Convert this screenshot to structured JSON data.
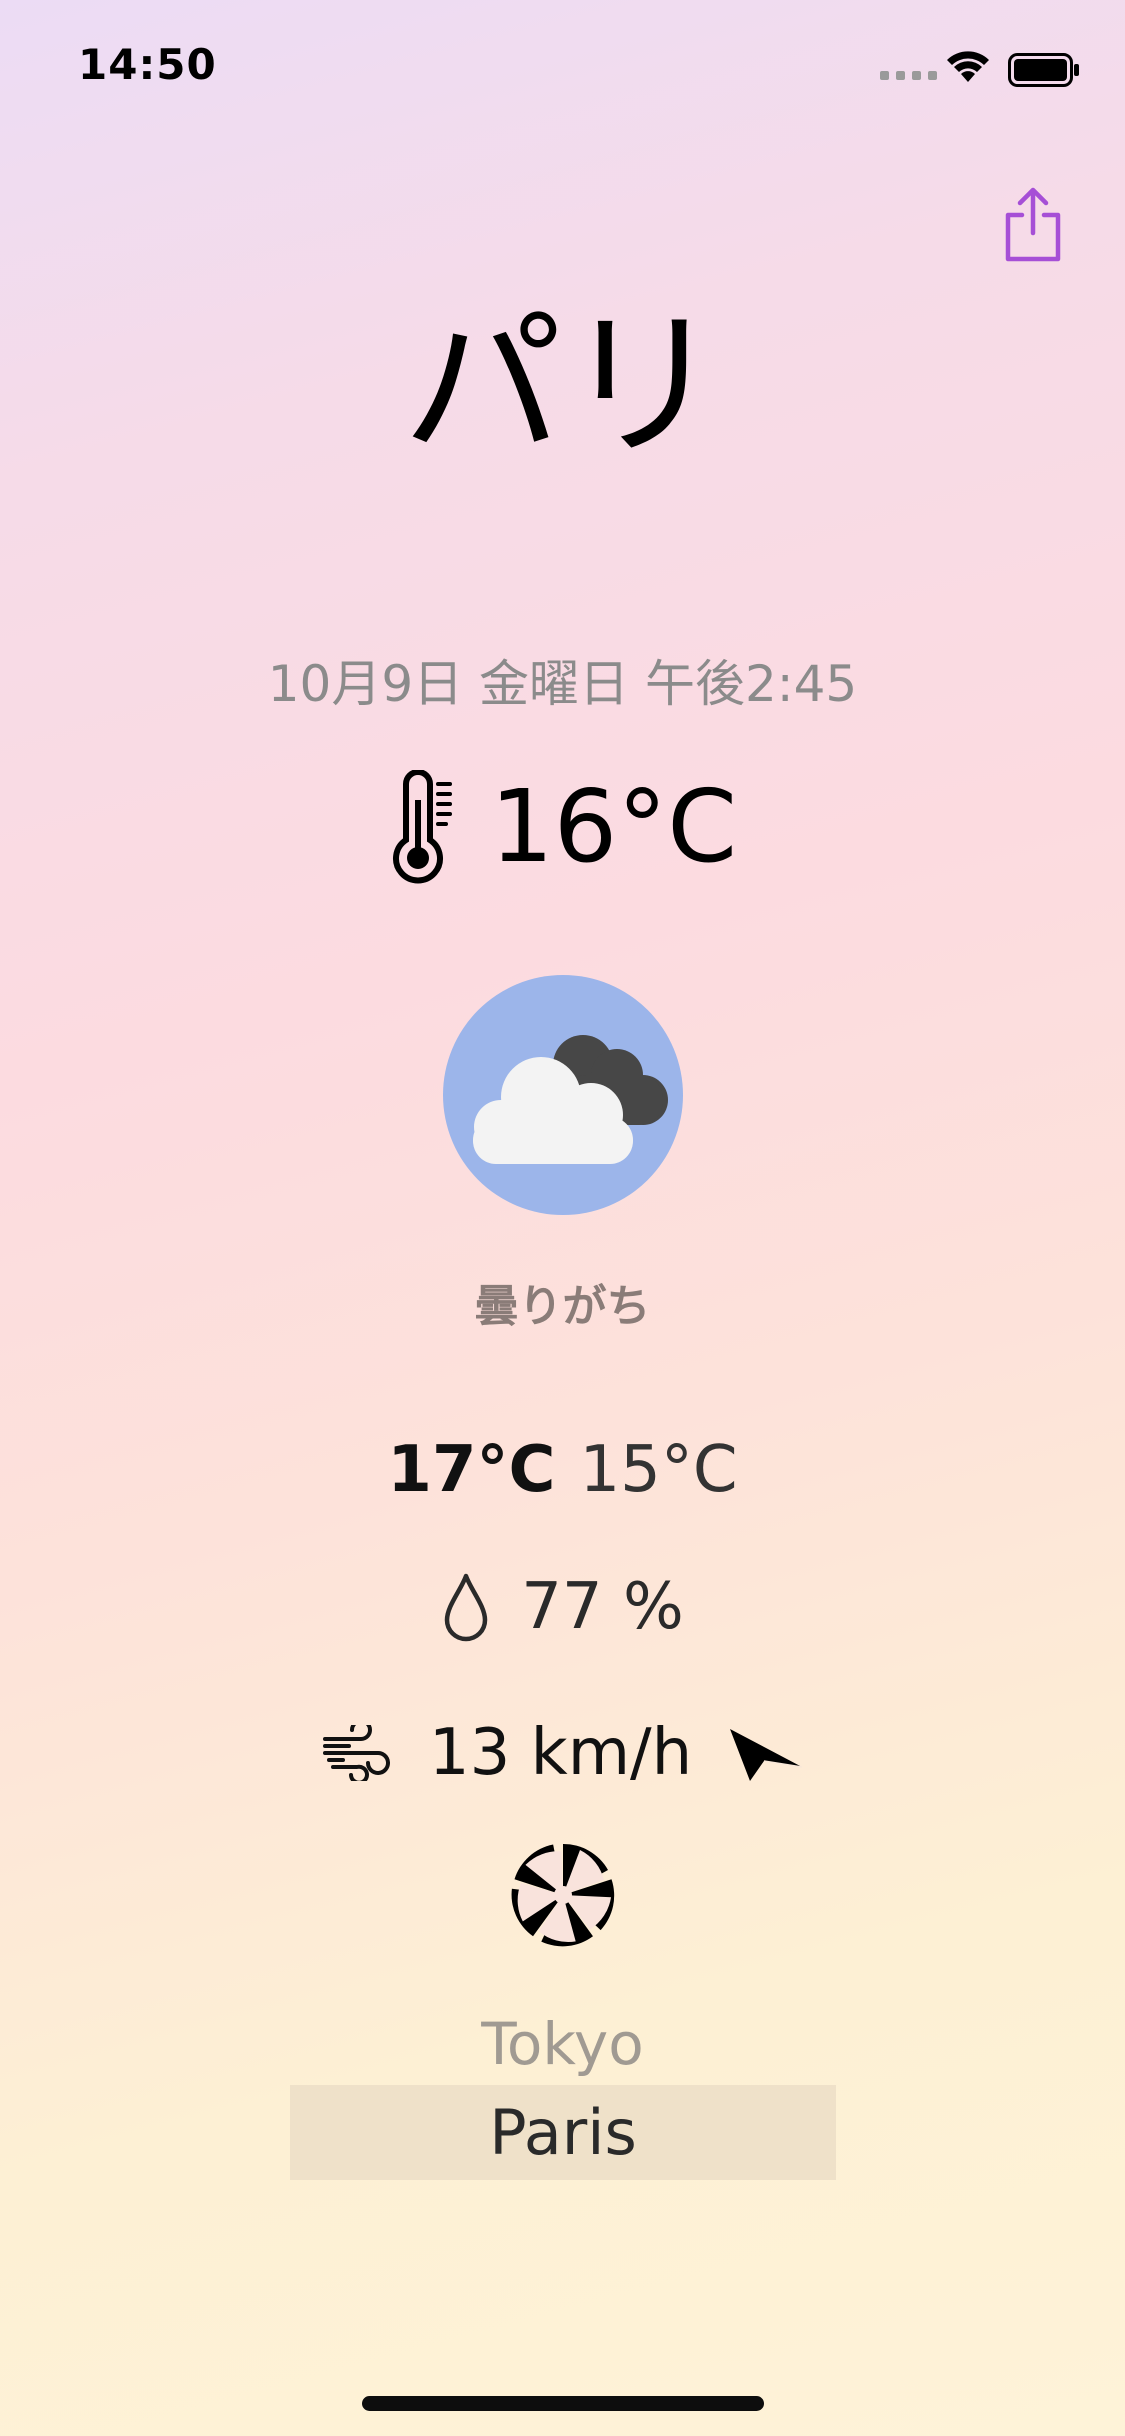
{
  "status_bar": {
    "time": "14:50"
  },
  "header": {
    "city_title": "パリ",
    "share_icon": "share-icon"
  },
  "weather": {
    "datetime": "10月9日 金曜日 午後2:45",
    "temperature": "16°C",
    "condition_icon": "cloudy-icon",
    "condition": "曇りがち",
    "temp_max": "17°C",
    "temp_min": "15°C",
    "humidity": "77 %",
    "wind_speed": "13 km/h",
    "wind_direction_icon": "wind-direction-arrow-icon"
  },
  "city_picker": {
    "options": [
      "Tokyo",
      "Paris"
    ],
    "selected": "Paris"
  },
  "colors": {
    "accent": "#a64fd6",
    "weather_circle": "#9cb5ea",
    "picker_highlight": "#efe1c9"
  }
}
